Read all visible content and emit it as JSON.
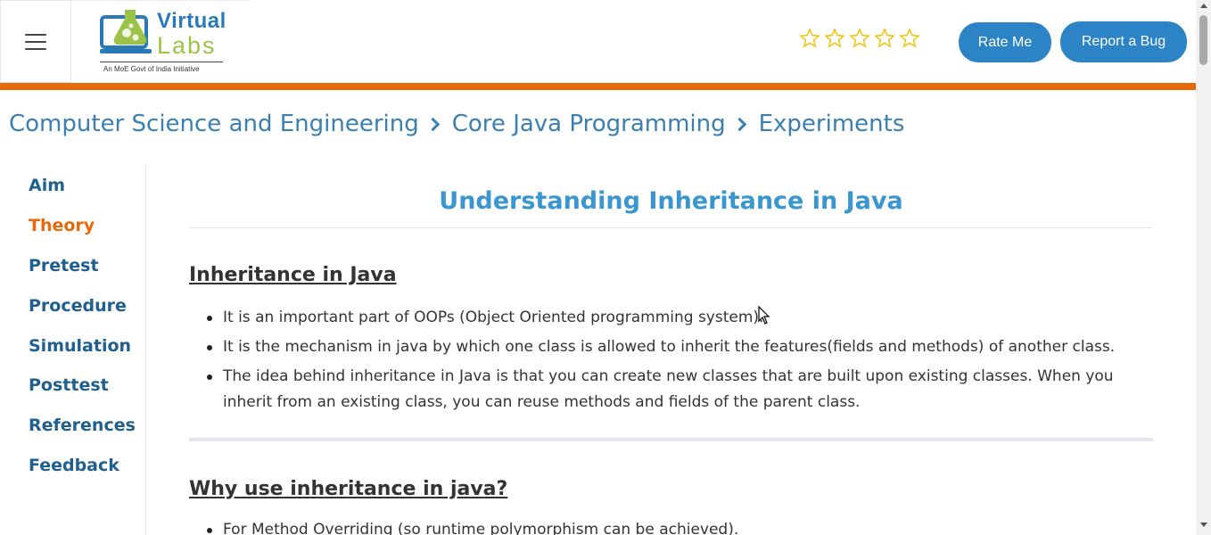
{
  "header": {
    "logo": {
      "line1": "Virtual",
      "line2": "Labs",
      "tagline": "An MoE Govt of India Initiative"
    },
    "rating": {
      "stars": 5,
      "filled": 0,
      "star_color": "#f0c419"
    },
    "rate_button": "Rate Me",
    "bug_button": "Report a Bug",
    "accent_color": "#e8690b",
    "button_color": "#2c84c7"
  },
  "breadcrumb": {
    "items": [
      "Computer Science and Engineering",
      "Core Java Programming",
      "Experiments"
    ]
  },
  "sidebar": {
    "items": [
      {
        "label": "Aim",
        "active": false
      },
      {
        "label": "Theory",
        "active": true
      },
      {
        "label": "Pretest",
        "active": false
      },
      {
        "label": "Procedure",
        "active": false
      },
      {
        "label": "Simulation",
        "active": false
      },
      {
        "label": "Posttest",
        "active": false
      },
      {
        "label": "References",
        "active": false
      },
      {
        "label": "Feedback",
        "active": false
      }
    ]
  },
  "main": {
    "title": "Understanding Inheritance in Java",
    "sections": [
      {
        "heading": "Inheritance in Java",
        "bullets": [
          "It is an important part of OOPs (Object Oriented programming system).",
          "It is the mechanism in java by which one class is allowed to inherit the features(fields and methods) of another class.",
          "The idea behind inheritance in Java is that you can create new classes that are built upon existing classes. When you inherit from an existing class, you can reuse methods and fields of the parent class."
        ]
      },
      {
        "heading": "Why use inheritance in java?",
        "bullets": [
          "For Method Overriding (so runtime polymorphism can be achieved)."
        ]
      }
    ]
  }
}
